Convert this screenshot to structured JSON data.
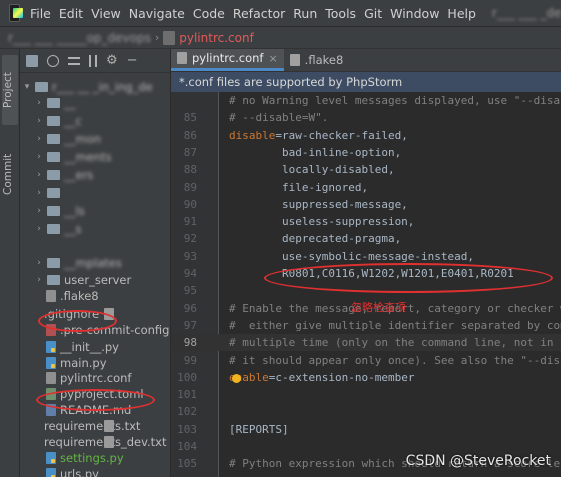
{
  "menubar": {
    "items": [
      "File",
      "Edit",
      "View",
      "Navigate",
      "Code",
      "Refactor",
      "Run",
      "Tools",
      "Git",
      "Window",
      "Help"
    ],
    "mnemonics": [
      "F",
      "E",
      "V",
      "N",
      "C",
      "R",
      "u",
      "T",
      "G",
      "W",
      "H"
    ],
    "window_title": "r___ ___ _develop_de"
  },
  "breadcrumb": {
    "project": "r___ ___ _____op_devops",
    "file": "pylintrc.conf"
  },
  "left_stripe": {
    "project_tab": "Project",
    "commit_tab": "Commit"
  },
  "tree": {
    "root": "r___ __ _in_ing_de",
    "items": [
      {
        "type": "folder",
        "label": "__",
        "blurred": true
      },
      {
        "type": "folder",
        "label": "__c",
        "blurred": true
      },
      {
        "type": "folder",
        "label": "__mon",
        "blurred": true
      },
      {
        "type": "folder",
        "label": "__ments",
        "blurred": true
      },
      {
        "type": "folder",
        "label": "__ers",
        "blurred": true
      },
      {
        "type": "folder",
        "label": "",
        "blurred": true
      },
      {
        "type": "folder",
        "label": "__ls",
        "blurred": true
      },
      {
        "type": "folder",
        "label": "__s",
        "blurred": true
      },
      {
        "type": "folder",
        "label": "__mplates",
        "blurred": true
      },
      {
        "type": "folder",
        "label": "user_server",
        "blurred": false
      },
      {
        "type": "cfg",
        "label": ".flake8",
        "blurred": false
      },
      {
        "type": "txt",
        "label": ".gitignore",
        "blurred": false
      },
      {
        "type": "yml",
        "label": ".pre-commit-config.y",
        "blurred": false
      },
      {
        "type": "py",
        "label": "__init__.py",
        "blurred": false
      },
      {
        "type": "py",
        "label": "main.py",
        "blurred": false
      },
      {
        "type": "cfg",
        "label": "pylintrc.conf",
        "blurred": false
      },
      {
        "type": "toml",
        "label": "pyproject.toml",
        "blurred": false
      },
      {
        "type": "md",
        "label": "README.md",
        "blurred": false
      },
      {
        "type": "txt",
        "label": "requirements.txt",
        "blurred": false
      },
      {
        "type": "txt",
        "label": "requirements_dev.txt",
        "blurred": false
      },
      {
        "type": "py",
        "label": "settings.py",
        "blurred": false
      },
      {
        "type": "py",
        "label": "urls.py",
        "blurred": false
      }
    ]
  },
  "tabs": [
    {
      "label": "pylintrc.conf",
      "active": true
    },
    {
      "label": ".flake8",
      "active": false
    }
  ],
  "notice": "*.conf files are supported by PhpStorm",
  "code_lines": [
    {
      "num": "",
      "text": "# no Warning level messages displayed, use \"--disable",
      "kind": "comment"
    },
    {
      "num": "85",
      "text": "# --disable=W\".",
      "kind": "comment"
    },
    {
      "num": "86",
      "key": "disable",
      "text": "raw-checker-failed,",
      "kind": "kv"
    },
    {
      "num": "87",
      "text": "        bad-inline-option,",
      "kind": "val"
    },
    {
      "num": "88",
      "text": "        locally-disabled,",
      "kind": "val"
    },
    {
      "num": "89",
      "text": "        file-ignored,",
      "kind": "val"
    },
    {
      "num": "90",
      "text": "        suppressed-message,",
      "kind": "val"
    },
    {
      "num": "91",
      "text": "        useless-suppression,",
      "kind": "val"
    },
    {
      "num": "92",
      "text": "        deprecated-pragma,",
      "kind": "val"
    },
    {
      "num": "93",
      "text": "        use-symbolic-message-instead,",
      "kind": "val"
    },
    {
      "num": "94",
      "text": "        R0801,C0116,W1202,W1201,E0401,R0201",
      "kind": "val"
    },
    {
      "num": "95",
      "text": "",
      "kind": "val"
    },
    {
      "num": "96",
      "text": "# Enable the message, report, category or checker wi",
      "kind": "comment"
    },
    {
      "num": "97",
      "text": "#  either give multiple identifier separated by comma",
      "kind": "comment"
    },
    {
      "num": "98",
      "text": "# multiple time (only on the command line, not in th",
      "kind": "comment",
      "current": true
    },
    {
      "num": "99",
      "text": "# it should appear only once). See also the \"--disab",
      "kind": "comment"
    },
    {
      "num": "100",
      "key": "enable",
      "text": "c-extension-no-member",
      "kind": "kv"
    },
    {
      "num": "101",
      "text": "",
      "kind": "val"
    },
    {
      "num": "102",
      "text": "",
      "kind": "val"
    },
    {
      "num": "103",
      "text": "[REPORTS]",
      "kind": "sect"
    },
    {
      "num": "104",
      "text": "",
      "kind": "val"
    },
    {
      "num": "105",
      "text": "# Python expression which should return a score less",
      "kind": "comment"
    }
  ],
  "annotation": {
    "label": "忽略检查项"
  },
  "watermark": "CSDN @SteveRocket",
  "colors": {
    "annotation": "#e03030",
    "tab_accent": "#4a88c7",
    "notice_bg": "#3d4c63"
  }
}
